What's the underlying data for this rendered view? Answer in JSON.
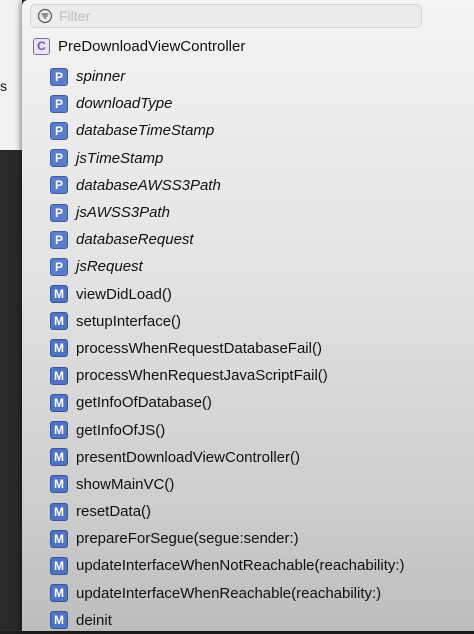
{
  "left_fragment": {
    "text": "s"
  },
  "filter": {
    "placeholder": "Filter",
    "icon": "filter-icon"
  },
  "class": {
    "badge": "C",
    "name": "PreDownloadViewController"
  },
  "members": [
    {
      "kind": "P",
      "name": "spinner",
      "type": "property"
    },
    {
      "kind": "P",
      "name": "downloadType",
      "type": "property"
    },
    {
      "kind": "P",
      "name": "databaseTimeStamp",
      "type": "property"
    },
    {
      "kind": "P",
      "name": "jsTimeStamp",
      "type": "property"
    },
    {
      "kind": "P",
      "name": "databaseAWSS3Path",
      "type": "property"
    },
    {
      "kind": "P",
      "name": "jsAWSS3Path",
      "type": "property"
    },
    {
      "kind": "P",
      "name": "databaseRequest",
      "type": "property"
    },
    {
      "kind": "P",
      "name": "jsRequest",
      "type": "property"
    },
    {
      "kind": "M",
      "name": "viewDidLoad()",
      "type": "method"
    },
    {
      "kind": "M",
      "name": "setupInterface()",
      "type": "method"
    },
    {
      "kind": "M",
      "name": "processWhenRequestDatabaseFail()",
      "type": "method"
    },
    {
      "kind": "M",
      "name": "processWhenRequestJavaScriptFail()",
      "type": "method"
    },
    {
      "kind": "M",
      "name": "getInfoOfDatabase()",
      "type": "method"
    },
    {
      "kind": "M",
      "name": "getInfoOfJS()",
      "type": "method"
    },
    {
      "kind": "M",
      "name": "presentDownloadViewController()",
      "type": "method"
    },
    {
      "kind": "M",
      "name": "showMainVC()",
      "type": "method"
    },
    {
      "kind": "M",
      "name": "resetData()",
      "type": "method"
    },
    {
      "kind": "M",
      "name": "prepareForSegue(segue:sender:)",
      "type": "method"
    },
    {
      "kind": "M",
      "name": "updateInterfaceWhenNotReachable(reachability:)",
      "type": "method"
    },
    {
      "kind": "M",
      "name": "updateInterfaceWhenReachable(reachability:)",
      "type": "method"
    },
    {
      "kind": "M",
      "name": "deinit",
      "type": "method"
    }
  ],
  "colors": {
    "property_badge": "#5b7cc8",
    "method_badge": "#4f73c2",
    "class_badge": "#7d6aa8"
  }
}
